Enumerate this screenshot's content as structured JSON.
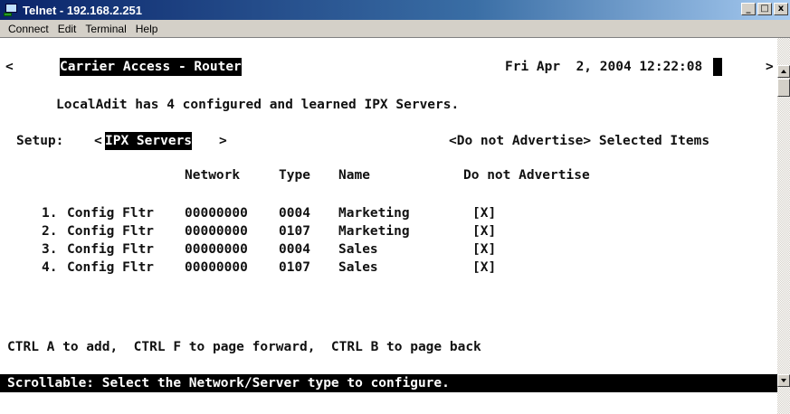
{
  "window": {
    "title": "Telnet - 192.168.2.251",
    "buttons": {
      "minimize": "_",
      "maximize": "□",
      "close": "x"
    }
  },
  "menu": [
    "Connect",
    "Edit",
    "Terminal",
    "Help"
  ],
  "screen": {
    "left_marker": "<",
    "right_marker": ">",
    "title": "Carrier Access - Router",
    "datetime": "Fri Apr  2, 2004 12:22:08",
    "cursor": " ",
    "info": "LocalAdit has 4 configured and learned IPX Servers.",
    "setup_label": "Setup:",
    "setup_open": "<",
    "setup_value": "IPX Servers",
    "setup_close": ">",
    "selection_hint": "<Do not Advertise> Selected Items",
    "columns": {
      "network": "Network",
      "type": "Type",
      "name": "Name",
      "do_not_advertise": "Do not Advertise"
    },
    "rows": [
      {
        "index": "1.",
        "kind": "Config Fltr",
        "network": "00000000",
        "type": "0004",
        "name": "Marketing",
        "do_not_advertise": "[X]"
      },
      {
        "index": "2.",
        "kind": "Config Fltr",
        "network": "00000000",
        "type": "0107",
        "name": "Marketing",
        "do_not_advertise": "[X]"
      },
      {
        "index": "3.",
        "kind": "Config Fltr",
        "network": "00000000",
        "type": "0004",
        "name": "Sales",
        "do_not_advertise": "[X]"
      },
      {
        "index": "4.",
        "kind": "Config Fltr",
        "network": "00000000",
        "type": "0107",
        "name": "Sales",
        "do_not_advertise": "[X]"
      }
    ],
    "help_line": "CTRL A to add,  CTRL F to page forward,  CTRL B to page back",
    "status_line": "Scrollable: Select the Network/Server type to configure."
  }
}
